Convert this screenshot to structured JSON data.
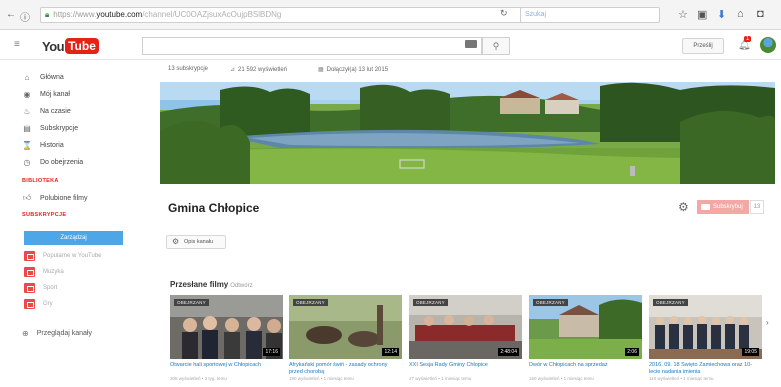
{
  "browser": {
    "url_dim": "https://www.",
    "url_host": "youtube.com",
    "url_path": "/channel/UC0OAZjsuxAcOujpBSlBDNg",
    "search_placeholder": "Szukaj"
  },
  "header": {
    "logo_you": "You",
    "logo_tube": "Tube",
    "upload_label": "Prześlij",
    "notif_count": "1"
  },
  "sidebar": {
    "items": [
      {
        "icon": "home-icon",
        "glyph": "⌂",
        "label": "Główna"
      },
      {
        "icon": "person-icon",
        "glyph": "◉",
        "label": "Mój kanał"
      },
      {
        "icon": "flame-icon",
        "glyph": "♨",
        "label": "Na czasie"
      },
      {
        "icon": "subscriptions-icon",
        "glyph": "▤",
        "label": "Subskrypcje"
      },
      {
        "icon": "hourglass-icon",
        "glyph": "⌛",
        "label": "Historia"
      },
      {
        "icon": "clock-icon",
        "glyph": "◷",
        "label": "Do obejrzenia"
      }
    ],
    "library_heading": "BIBLIOTEKA",
    "liked_label": "Polubione filmy",
    "subs_heading": "SUBSKRYPCJE",
    "manage_label": "Zarządzaj",
    "subs": [
      {
        "label": "Popularne w YouTube"
      },
      {
        "label": "Muzyka"
      },
      {
        "label": "Sport"
      },
      {
        "label": "Gry"
      }
    ],
    "browse_label": "Przeglądaj kanały"
  },
  "channel": {
    "stats": [
      {
        "icon": "subs-icon",
        "glyph": "",
        "label": "13 subskrypcje"
      },
      {
        "icon": "views-icon",
        "glyph": "⊿",
        "label": "21 592 wyświetleń"
      },
      {
        "icon": "calendar-icon",
        "glyph": "▦",
        "label": "Dołączył(a) 13 lut 2015"
      }
    ],
    "title": "Gmina Chłopice",
    "subscribe_label": "Subskrybuj",
    "subscriber_count": "13",
    "desc_label": "Opis kanału"
  },
  "uploads": {
    "heading": "Przesłane filmy",
    "sub": "Odtwórz",
    "watched_label": "OBEJRZANY",
    "videos": [
      {
        "duration": "17:16",
        "title": "Otwarcie hali sportowej w Chłopicach",
        "meta": "305 wyświetleń • 3 tyg. temu"
      },
      {
        "duration": "12:14",
        "title": "Afrykański pomór świń - zasady ochrony przed chorobą",
        "meta": "190 wyświetleń • 1 miesiąc temu"
      },
      {
        "duration": "2:48:04",
        "title": "XXI Sesja Rady Gminy Chłopice",
        "meta": "27 wyświetleń • 1 miesiąc temu"
      },
      {
        "duration": "2:06",
        "title": "Dwór w Chłopicach na sprzedaż",
        "meta": "160 wyświetleń • 1 miesiąc temu"
      },
      {
        "duration": "19:05",
        "title": "2016. 09. 18 Święto Zamiechowa oraz 10-lecie nadania imienia",
        "meta": "110 wyświetleń • 1 miesiąc temu"
      }
    ]
  }
}
